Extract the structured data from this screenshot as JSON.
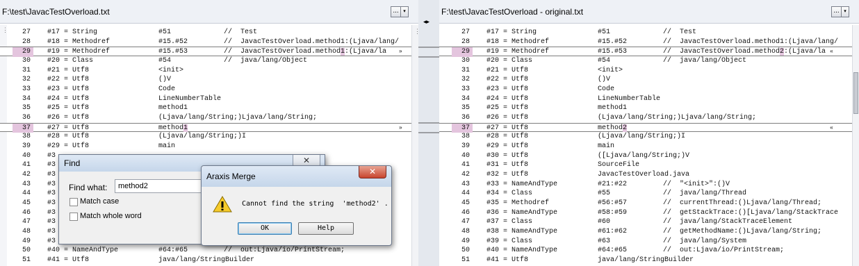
{
  "left_pane": {
    "path": "F:\\test\\JavacTestOverload.txt",
    "browse_label": "...",
    "menu_label": "▾"
  },
  "right_pane": {
    "path": "F:\\test\\JavacTestOverload - original.txt",
    "browse_label": "...",
    "menu_label": "▾"
  },
  "gutter": {
    "sync_arrows": "◂▸"
  },
  "left_lines": [
    {
      "n": "27",
      "t1": "#17 = String",
      "t2": "#51",
      "t3": "//  Test"
    },
    {
      "n": "28",
      "t1": "#18 = Methodref",
      "t2": "#15.#52",
      "t3": "//  JavacTestOverload.method1:(Ljava/lang/"
    },
    {
      "n": "29",
      "t1": "#19 = Methodref",
      "t2": "#15.#53",
      "t3a": "//  JavacTestOverload.method",
      "t3h": "1",
      "t3b": ":(Ljava/la",
      "sel": true,
      "arrow": "»"
    },
    {
      "n": "30",
      "t1": "#20 = Class",
      "t2": "#54",
      "t3": "//  java/lang/Object"
    },
    {
      "n": "31",
      "t1": "#21 = Utf8",
      "t2": "<init>"
    },
    {
      "n": "32",
      "t1": "#22 = Utf8",
      "t2": "()V"
    },
    {
      "n": "33",
      "t1": "#23 = Utf8",
      "t2": "Code"
    },
    {
      "n": "34",
      "t1": "#24 = Utf8",
      "t2": "LineNumberTable"
    },
    {
      "n": "35",
      "t1": "#25 = Utf8",
      "t2": "method1"
    },
    {
      "n": "36",
      "t1": "#26 = Utf8",
      "t2": "(Ljava/lang/String;)Ljava/lang/String;"
    },
    {
      "n": "37",
      "t1": "#27 = Utf8",
      "t2a": "method",
      "t2h": "1",
      "sel": true,
      "arrow": "»"
    },
    {
      "n": "38",
      "t1": "#28 = Utf8",
      "t2": "(Ljava/lang/String;)I"
    },
    {
      "n": "39",
      "t1": "#29 = Utf8",
      "t2": "main"
    },
    {
      "n": "40",
      "t1": "#3"
    },
    {
      "n": "41",
      "t1": "#3"
    },
    {
      "n": "42",
      "t1": "#3"
    },
    {
      "n": "43",
      "t1": "#3"
    },
    {
      "n": "44",
      "t1": "#3"
    },
    {
      "n": "45",
      "t1": "#3"
    },
    {
      "n": "46",
      "t1": "#3",
      "t3": "Trace"
    },
    {
      "n": "47",
      "t1": "#3"
    },
    {
      "n": "48",
      "t1": "#3"
    },
    {
      "n": "49",
      "t1": "#3"
    },
    {
      "n": "50",
      "t1": "#40 = NameAndType",
      "t2": "#64:#65",
      "t3": "//  out:Ljava/io/PrintStream;"
    },
    {
      "n": "51",
      "t1": "#41 = Utf8",
      "t2": "java/lang/StringBuilder"
    }
  ],
  "right_lines": [
    {
      "n": "27",
      "t1": "#17 = String",
      "t2": "#51",
      "t3": "//  Test"
    },
    {
      "n": "28",
      "t1": "#18 = Methodref",
      "t2": "#15.#52",
      "t3": "//  JavacTestOverload.method1:(Ljava/lang/"
    },
    {
      "n": "29",
      "t1": "#19 = Methodref",
      "t2": "#15.#53",
      "t3a": "//  JavacTestOverload.method",
      "t3h": "2",
      "t3b": ":(Ljava/la",
      "sel": true,
      "arrow": "«"
    },
    {
      "n": "30",
      "t1": "#20 = Class",
      "t2": "#54",
      "t3": "//  java/lang/Object"
    },
    {
      "n": "31",
      "t1": "#21 = Utf8",
      "t2": "<init>"
    },
    {
      "n": "32",
      "t1": "#22 = Utf8",
      "t2": "()V"
    },
    {
      "n": "33",
      "t1": "#23 = Utf8",
      "t2": "Code"
    },
    {
      "n": "34",
      "t1": "#24 = Utf8",
      "t2": "LineNumberTable"
    },
    {
      "n": "35",
      "t1": "#25 = Utf8",
      "t2": "method1"
    },
    {
      "n": "36",
      "t1": "#26 = Utf8",
      "t2": "(Ljava/lang/String;)Ljava/lang/String;"
    },
    {
      "n": "37",
      "t1": "#27 = Utf8",
      "t2a": "method",
      "t2h": "2",
      "sel": true,
      "arrow": "«"
    },
    {
      "n": "38",
      "t1": "#28 = Utf8",
      "t2": "(Ljava/lang/String;)I"
    },
    {
      "n": "39",
      "t1": "#29 = Utf8",
      "t2": "main"
    },
    {
      "n": "40",
      "t1": "#30 = Utf8",
      "t2": "([Ljava/lang/String;)V"
    },
    {
      "n": "41",
      "t1": "#31 = Utf8",
      "t2": "SourceFile"
    },
    {
      "n": "42",
      "t1": "#32 = Utf8",
      "t2": "JavacTestOverload.java"
    },
    {
      "n": "43",
      "t1": "#33 = NameAndType",
      "t2": "#21:#22",
      "t3": "//  \"<init>\":()V"
    },
    {
      "n": "44",
      "t1": "#34 = Class",
      "t2": "#55",
      "t3": "//  java/lang/Thread"
    },
    {
      "n": "45",
      "t1": "#35 = Methodref",
      "t2": "#56:#57",
      "t3": "//  currentThread:()Ljava/lang/Thread;"
    },
    {
      "n": "46",
      "t1": "#36 = NameAndType",
      "t2": "#58:#59",
      "t3": "//  getStackTrace:()[Ljava/lang/StackTrace"
    },
    {
      "n": "47",
      "t1": "#37 = Class",
      "t2": "#60",
      "t3": "//  java/lang/StackTraceElement"
    },
    {
      "n": "48",
      "t1": "#38 = NameAndType",
      "t2": "#61:#62",
      "t3": "//  getMethodName:()Ljava/lang/String;"
    },
    {
      "n": "49",
      "t1": "#39 = Class",
      "t2": "#63",
      "t3": "//  java/lang/System"
    },
    {
      "n": "50",
      "t1": "#40 = NameAndType",
      "t2": "#64:#65",
      "t3": "//  out:Ljava/io/PrintStream;"
    },
    {
      "n": "51",
      "t1": "#41 = Utf8",
      "t2": "java/lang/StringBuilder"
    }
  ],
  "find_dialog": {
    "title": "Find",
    "close_label": "✕",
    "find_what_label": "Find what:",
    "find_what_value": "method2",
    "match_case_label": "Match case",
    "match_whole_word_label": "Match whole word"
  },
  "alert_dialog": {
    "title": "Araxis Merge",
    "close_label": "✕",
    "message": "Cannot find the string  'method2' .",
    "ok_label": "OK",
    "help_label": "Help"
  }
}
